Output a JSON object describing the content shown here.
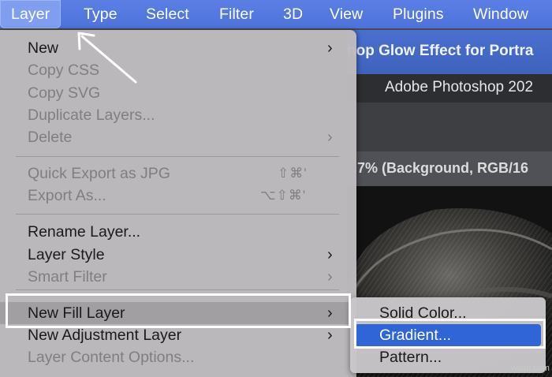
{
  "menubar": {
    "items": [
      "Layer",
      "Type",
      "Select",
      "Filter",
      "3D",
      "View",
      "Plugins",
      "Window"
    ],
    "active_index": 0
  },
  "photoshop_window": {
    "title_fragment": "hop Glow Effect for Portra",
    "app_title_fragment": "Adobe Photoshop 202",
    "doc_tab_fragment": ".7% (Background, RGB/16"
  },
  "layer_menu": {
    "items": [
      {
        "label": "New",
        "enabled": true,
        "submenu": true
      },
      {
        "label": "Copy CSS",
        "enabled": false
      },
      {
        "label": "Copy SVG",
        "enabled": false
      },
      {
        "label": "Duplicate Layers...",
        "enabled": false
      },
      {
        "label": "Delete",
        "enabled": false,
        "submenu": true
      },
      {
        "label": "Quick Export as JPG",
        "enabled": false,
        "shortcut": "⇧⌘'"
      },
      {
        "label": "Export As...",
        "enabled": false,
        "shortcut": "⌥⇧⌘'"
      },
      {
        "label": "Rename Layer...",
        "enabled": true
      },
      {
        "label": "Layer Style",
        "enabled": true,
        "submenu": true
      },
      {
        "label": "Smart Filter",
        "enabled": false,
        "submenu": true
      },
      {
        "label": "New Fill Layer",
        "enabled": true,
        "submenu": true,
        "highlighted": true
      },
      {
        "label": "New Adjustment Layer",
        "enabled": true,
        "submenu": true
      },
      {
        "label": "Layer Content Options...",
        "enabled": false
      }
    ]
  },
  "fill_submenu": {
    "items": [
      {
        "label": "Solid Color..."
      },
      {
        "label": "Gradient...",
        "selected": true
      },
      {
        "label": "Pattern..."
      }
    ]
  },
  "submenu_arrow_glyph": "›",
  "watermark": "wtvid.com",
  "colors": {
    "menubar": "#5277de",
    "selection": "#2f65d6",
    "annotation": "#ffffff"
  }
}
